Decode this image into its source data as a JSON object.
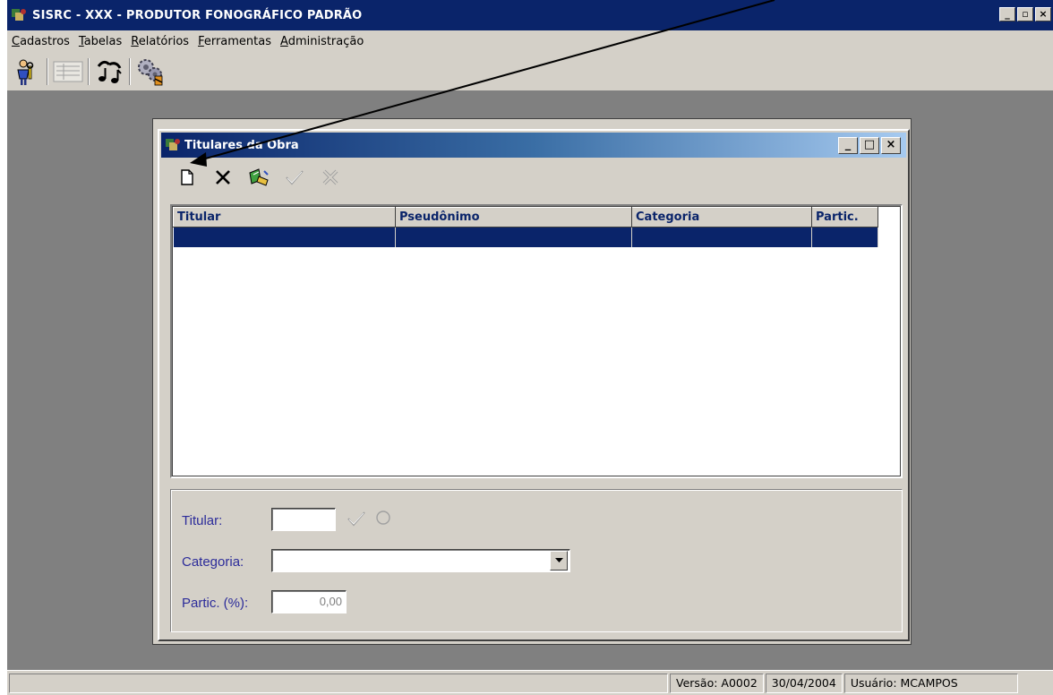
{
  "app": {
    "title": "SISRC - XXX - PRODUTOR FONOGRÁFICO PADRÃO",
    "window_controls": [
      "_",
      "▫",
      "×"
    ]
  },
  "menubar": {
    "items": [
      {
        "label": "Cadastros",
        "mnemonic": "C"
      },
      {
        "label": "Tabelas",
        "mnemonic": "T"
      },
      {
        "label": "Relatórios",
        "mnemonic": "R"
      },
      {
        "label": "Ferramentas",
        "mnemonic": "F"
      },
      {
        "label": "Administração",
        "mnemonic": "A"
      }
    ]
  },
  "toolbar": {
    "icons": [
      "person-key-icon",
      "form-list-icon",
      "music-notes-icon",
      "gears-icon"
    ]
  },
  "child_window": {
    "title": "Titulares da Obra",
    "window_controls": [
      "_",
      "□",
      "×"
    ],
    "toolbar_icons": [
      "new-document-icon",
      "delete-icon",
      "edit-icon",
      "confirm-icon",
      "cancel-icon"
    ]
  },
  "grid": {
    "columns": [
      "Titular",
      "Pseudônimo",
      "Categoria",
      "Partic."
    ],
    "rows": [
      [
        "",
        "",
        "",
        ""
      ]
    ]
  },
  "form": {
    "titular_label": "Titular:",
    "titular_value": "",
    "categoria_label": "Categoria:",
    "categoria_value": "",
    "partic_label": "Partic. (%):",
    "partic_value": "0,00"
  },
  "statusbar": {
    "version": "Versão: A0002",
    "date": "30/04/2004",
    "user": "Usuário: MCAMPOS"
  },
  "colors": {
    "titlebar": "#0a246a",
    "face": "#d4d0c8",
    "desktop": "#808080",
    "selection": "#0a246a",
    "label_text": "#2c2c9a"
  }
}
